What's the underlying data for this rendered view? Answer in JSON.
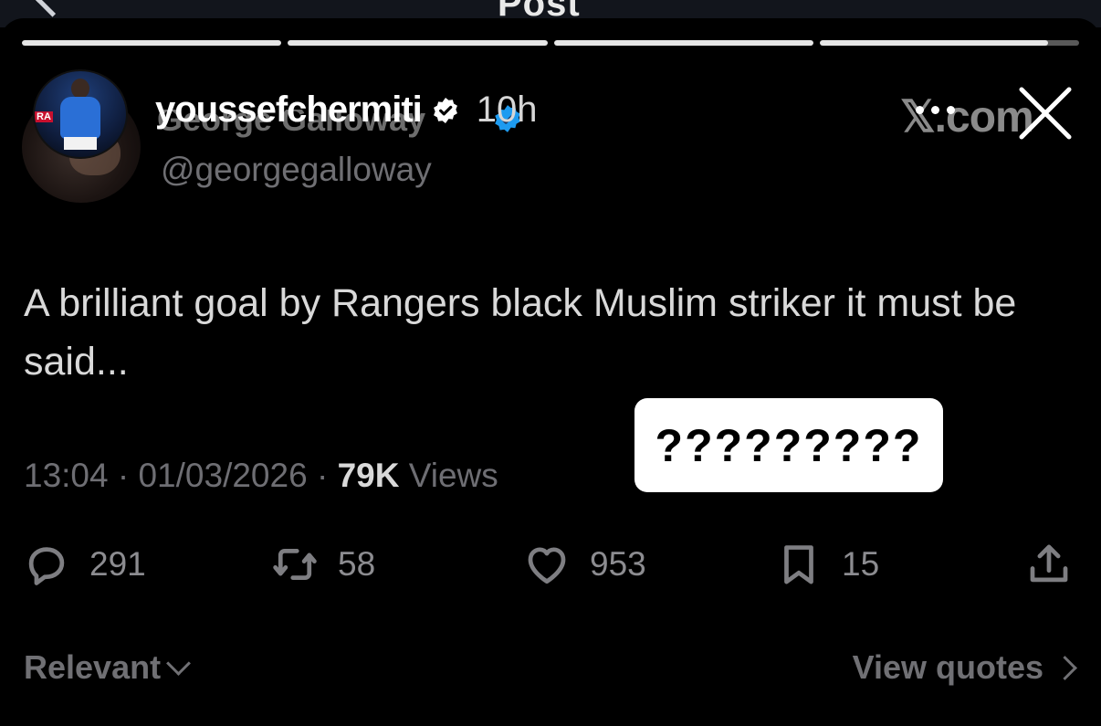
{
  "background_header": {
    "title": "Post"
  },
  "story": {
    "progress": [
      1.0,
      1.0,
      1.0,
      0.88
    ],
    "username": "youssefchermiti",
    "time_ago": "10h"
  },
  "tweet": {
    "author_name": "George Galloway",
    "handle": "@georgegalloway",
    "site_logo": "𝕏.com",
    "text": "A brilliant goal by Rangers black Muslim striker it must be said...",
    "time": "13:04",
    "date": "01/03/2026",
    "views_count": "79K",
    "views_label": "Views",
    "separator": "·",
    "actions": {
      "replies": "291",
      "reposts": "58",
      "likes": "953",
      "bookmarks": "15"
    },
    "sort_label": "Relevant",
    "view_quotes_label": "View quotes"
  },
  "sticker": {
    "text": "?????????"
  },
  "colors": {
    "background": "#000000",
    "verified_blue": "#1d9bf0",
    "text_primary": "#d9d9d9",
    "text_muted": "#6e6e73"
  },
  "icons": [
    "back-chevron-icon",
    "verified-badge-icon",
    "more-dots-icon",
    "close-icon",
    "reply-icon",
    "repost-icon",
    "like-icon",
    "bookmark-icon",
    "share-icon",
    "chevron-down-icon",
    "chevron-right-icon"
  ]
}
